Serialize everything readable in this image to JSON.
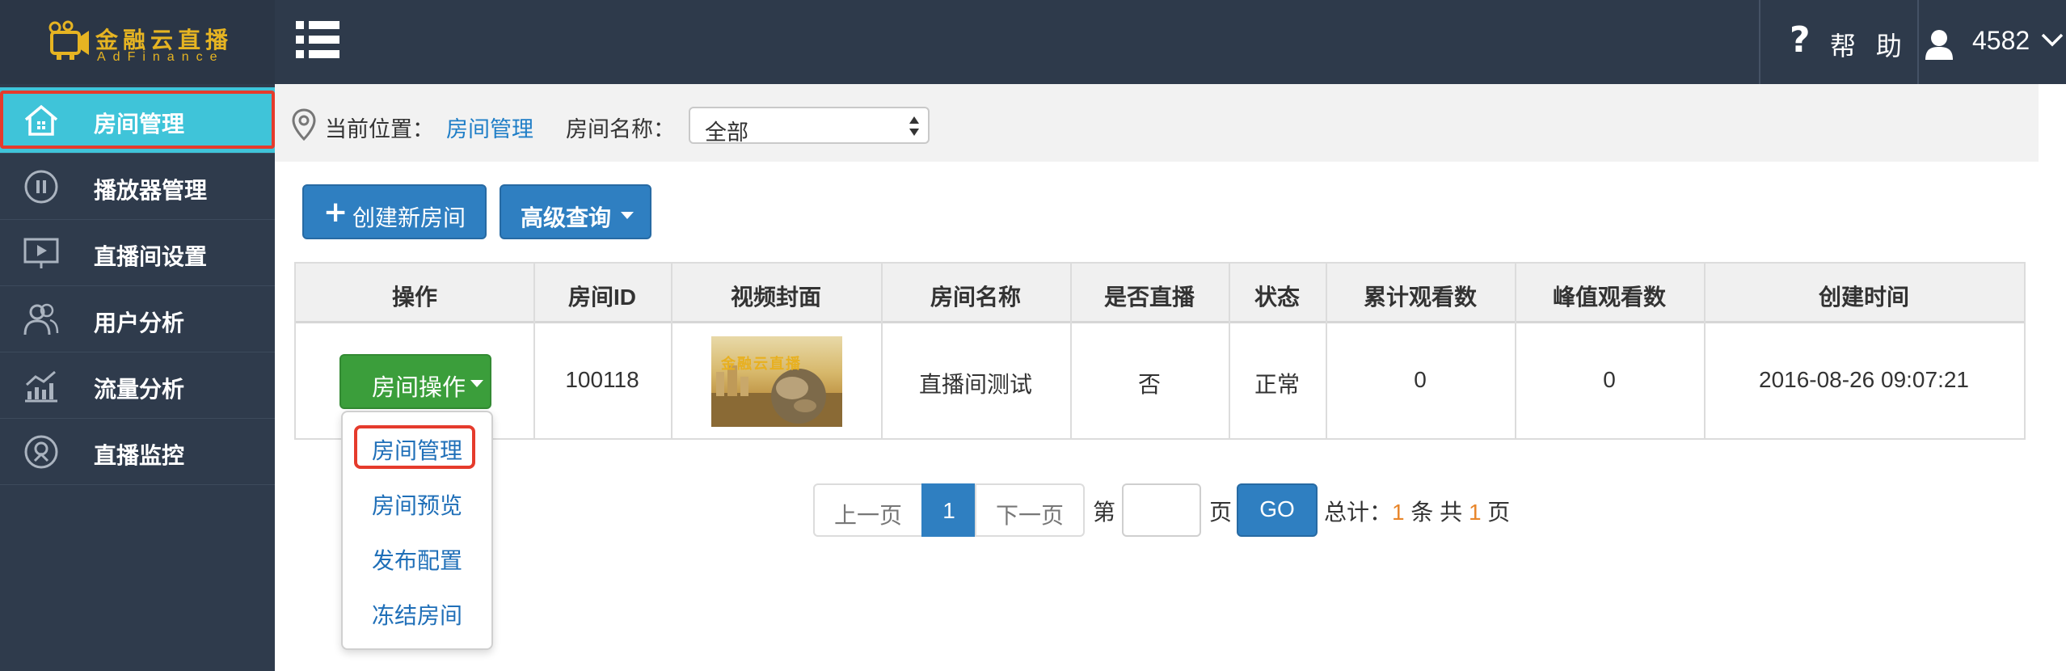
{
  "brand": {
    "name_cn": "金融云直播",
    "name_en": "AdFinance",
    "color": "#e6b422"
  },
  "header": {
    "help_label": "帮 助",
    "user_name": "4582"
  },
  "sidebar": {
    "items": [
      {
        "label": "房间管理",
        "icon": "home-icon",
        "active": true
      },
      {
        "label": "播放器管理",
        "icon": "pause-circle-icon"
      },
      {
        "label": "直播间设置",
        "icon": "monitor-play-icon"
      },
      {
        "label": "用户分析",
        "icon": "users-icon"
      },
      {
        "label": "流量分析",
        "icon": "bar-chart-icon"
      },
      {
        "label": "直播监控",
        "icon": "monitor-target-icon"
      }
    ]
  },
  "breadcrumb": {
    "label": "当前位置：",
    "current": "房间管理",
    "room_label": "房间名称：",
    "room_select_value": "全部"
  },
  "toolbar": {
    "create_label": "创建新房间",
    "advanced_label": "高级查询"
  },
  "table": {
    "headers": [
      "操作",
      "房间ID",
      "视频封面",
      "房间名称",
      "是否直播",
      "状态",
      "累计观看数",
      "峰值观看数",
      "创建时间"
    ],
    "rows": [
      {
        "action_label": "房间操作",
        "room_id": "100118",
        "cover_text": "金融云直播",
        "room_name": "直播间测试",
        "is_live": "否",
        "status": "正常",
        "total_views": "0",
        "peak_views": "0",
        "created_at": "2016-08-26 09:07:21"
      }
    ]
  },
  "dropdown": {
    "items": [
      "房间管理",
      "房间预览",
      "发布配置",
      "冻结房间"
    ]
  },
  "pagination": {
    "prev": "上一页",
    "current_page": "1",
    "next": "下一页",
    "jump_prefix": "第",
    "jump_suffix": "页",
    "go": "GO",
    "total_prefix": "总计：",
    "total_count": "1",
    "total_mid": " 条 共 ",
    "total_pages": "1",
    "total_suffix": " 页"
  },
  "colors": {
    "topbar": "#2e3a4b",
    "sidebar": "#2f3b4c",
    "active": "#3fc4d9",
    "primary": "#2f7fc1",
    "success": "#3b9e3b",
    "highlight": "#e53b2c",
    "link": "#1f6fb8",
    "accent_number": "#e8862b"
  }
}
